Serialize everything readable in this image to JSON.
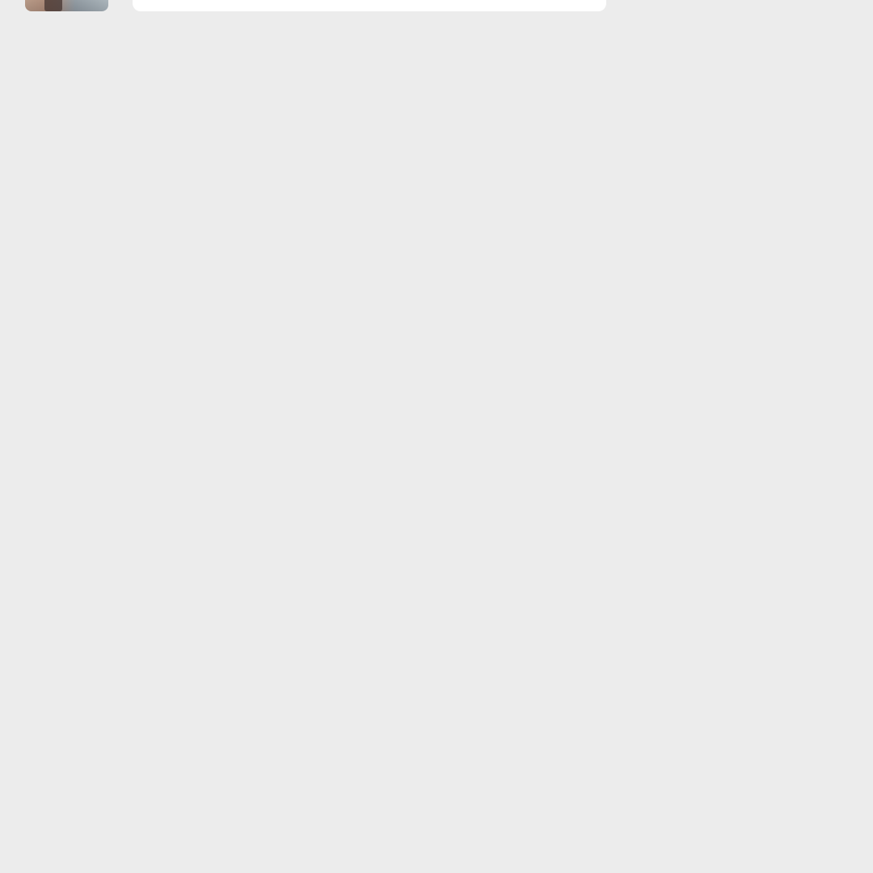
{
  "feed": {
    "items": [
      {
        "thumbnail": "photo-thumbnail",
        "card": "content-card"
      }
    ]
  },
  "colors": {
    "background": "#ececec",
    "card": "#ffffff"
  }
}
